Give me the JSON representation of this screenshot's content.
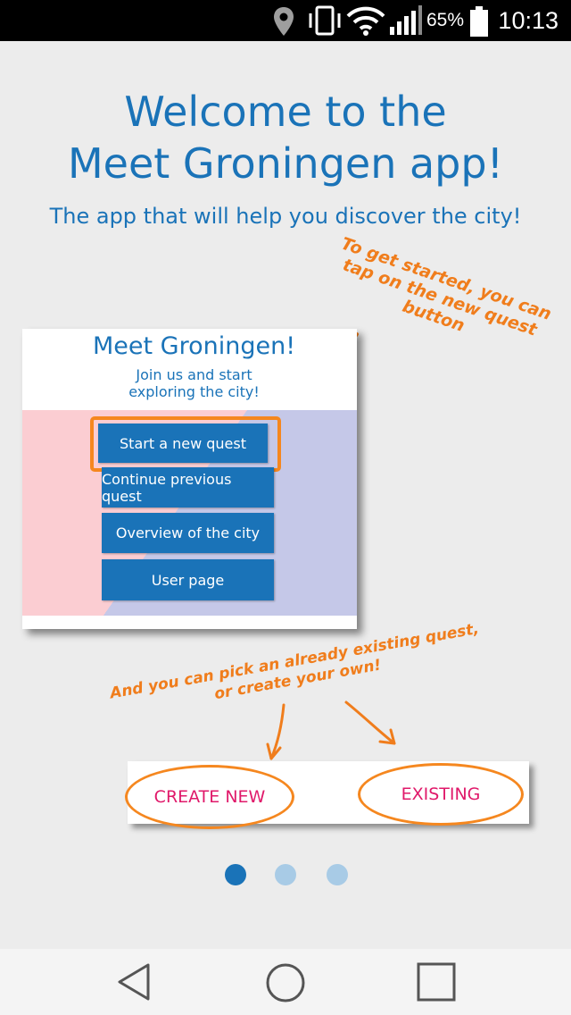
{
  "status_bar": {
    "battery_percent": "65%",
    "time": "10:13",
    "icons": [
      "location-icon",
      "vibrate-icon",
      "wifi-icon",
      "signal-icon",
      "battery-icon"
    ]
  },
  "welcome": {
    "title_line1": "Welcome to the",
    "title_line2": "Meet Groningen app!",
    "subtitle": "The app that will help you discover the city!"
  },
  "annotations": {
    "top": "To get started, you can tap on the new quest button",
    "bottom_line1": "And you can pick an already existing quest,",
    "bottom_line2": "or create your own!"
  },
  "preview": {
    "title": "Meet Groningen!",
    "subtitle_line1": "Join us and start",
    "subtitle_line2": "exploring the city!",
    "buttons": [
      {
        "label": "Start a new quest"
      },
      {
        "label": "Continue previous quest"
      },
      {
        "label": "Overview of the city"
      },
      {
        "label": "User page"
      }
    ]
  },
  "quest_options": {
    "create_label": "CREATE NEW",
    "existing_label": "EXISTING"
  },
  "pager": {
    "pages": 3,
    "current": 1
  },
  "colors": {
    "accent_blue": "#1a73b8",
    "highlight_orange": "#f5871f",
    "option_pink": "#e0196a",
    "dot_active": "#1a73b8",
    "dot_inactive": "#a8cbe6"
  },
  "nav_bar": {
    "icons": [
      "back-icon",
      "home-icon",
      "recents-icon"
    ]
  }
}
